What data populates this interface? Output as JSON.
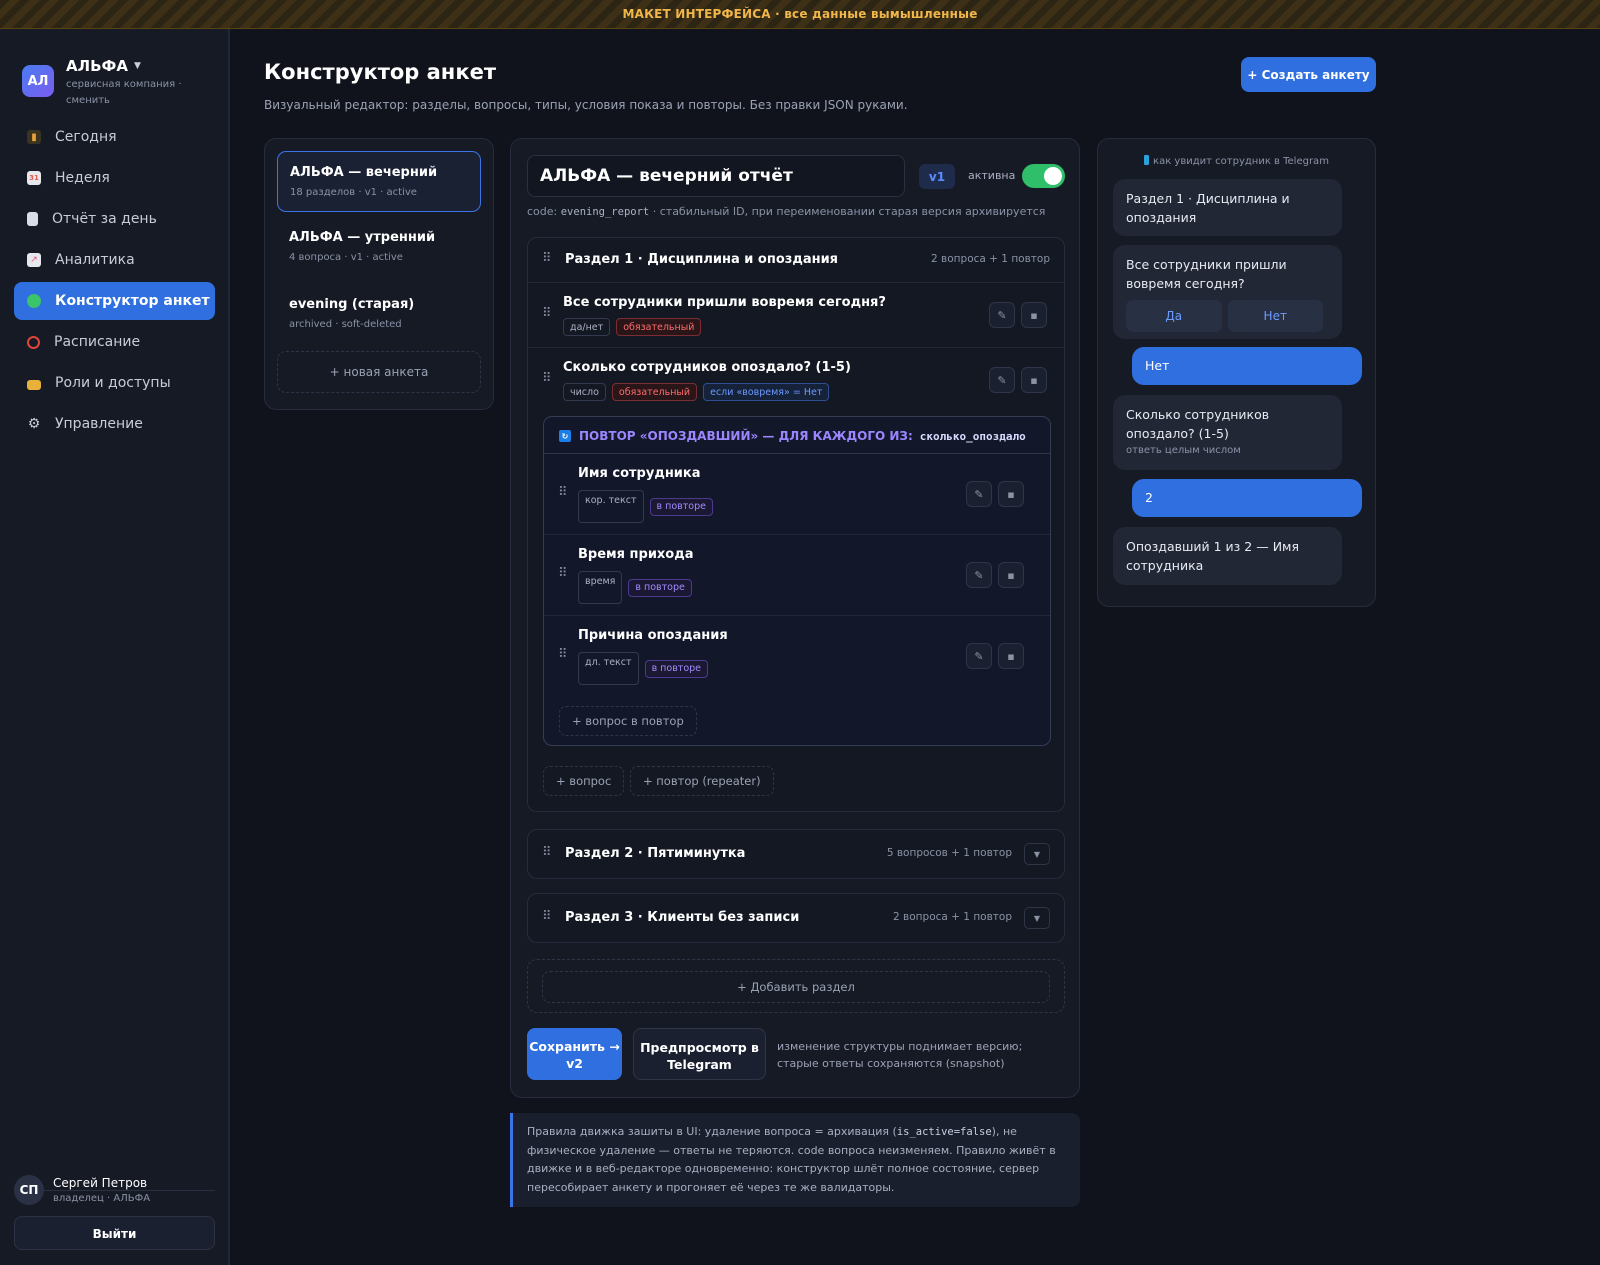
{
  "banner": {
    "text": "МАКЕТ ИНТЕРФЕЙСА · все данные вымышленные"
  },
  "org": {
    "logo": "АЛ",
    "name": "АЛЬФА",
    "sub": "сервисная компания · сменить"
  },
  "nav": [
    {
      "label": "Сегодня",
      "icon": "bar-chart-icon",
      "color": "#e8a23a"
    },
    {
      "label": "Неделя",
      "icon": "calendar-icon",
      "color": "#e05a4a"
    },
    {
      "label": "Отчёт за день",
      "icon": "document-icon",
      "color": "#d9dde6"
    },
    {
      "label": "Аналитика",
      "icon": "trend-icon",
      "color": "#e05a7a"
    },
    {
      "label": "Конструктор анкет",
      "icon": "puzzle-icon",
      "color": "#3bc46a"
    },
    {
      "label": "Расписание",
      "icon": "alarm-clock-icon",
      "color": "#e0443a"
    },
    {
      "label": "Роли и доступы",
      "icon": "lock-icon",
      "color": "#e8b23a"
    },
    {
      "label": "Управление",
      "icon": "gear-icon",
      "color": "#aab2c4"
    }
  ],
  "user": {
    "initials": "СП",
    "name": "Сергей Петров",
    "role": "владелец · АЛЬФА",
    "logout": "Выйти"
  },
  "header": {
    "title": "Конструктор анкет",
    "subtitle": "Визуальный редактор: разделы, вопросы, типы, условия показа и повторы. Без правки JSON руками.",
    "create_button": "+ Создать анкету"
  },
  "forms": [
    {
      "title": "АЛЬФА — вечерний",
      "sub": "18 разделов · v1 · active"
    },
    {
      "title": "АЛЬФА — утренний",
      "sub": "4 вопроса · v1 · active"
    },
    {
      "title": "evening (старая)",
      "sub": "archived · soft-deleted"
    }
  ],
  "new_form": "+ новая анкета",
  "editor": {
    "name": "АЛЬФА — вечерний отчёт",
    "version": "v1",
    "active_label": "активна",
    "active": true,
    "code_prefix": "code: ",
    "code": "evening_report",
    "code_suffix": " · стабильный ID, при переименовании старая версия архивируется"
  },
  "section1": {
    "title": "Раздел 1 · Дисциплина и опоздания",
    "count": "2 вопроса + 1 повтор",
    "q1": {
      "title": "Все сотрудники пришли вовремя сегодня?",
      "type": "да/нет",
      "required": "обязательный"
    },
    "q2": {
      "title": "Сколько сотрудников опоздало? (1-5)",
      "type": "число",
      "required": "обязательный",
      "condition": "если «вовремя» = Нет"
    },
    "repeater": {
      "title": "ПОВТОР «ОПОЗДАВШИЙ» — ДЛЯ КАЖДОГО ИЗ:",
      "source": "сколько_опоздало",
      "questions": [
        {
          "title": "Имя сотрудника",
          "type": "кор. текст",
          "tag": "в повторе"
        },
        {
          "title": "Время прихода",
          "type": "время",
          "tag": "в повторе"
        },
        {
          "title": "Причина опоздания",
          "type": "дл. текст",
          "tag": "в повторе"
        }
      ],
      "add_label": "+ вопрос в повтор"
    },
    "add_question": "+ вопрос",
    "add_repeater": "+ повтор (repeater)"
  },
  "section2": {
    "title": "Раздел 2 · Пятиминутка",
    "count": "5 вопросов + 1 повтор"
  },
  "section3": {
    "title": "Раздел 3 · Клиенты без записи",
    "count": "2 вопроса + 1 повтор"
  },
  "add_section": "+ Добавить раздел",
  "save_button": "Сохранить → v2",
  "preview_button": "Предпросмотр в Telegram",
  "save_note": "изменение структуры поднимает версию; старые ответы сохраняются (snapshot)",
  "rules": {
    "p1": "Правила движка зашиты в UI: удаление вопроса = архивация (",
    "code": "is_active=false",
    "p2": "), не физическое удаление — ответы не теряются. code вопроса неизменяем. Правило живёт в движке и в веб-редакторе одновременно: конструктор шлёт полное состояние, сервер пересобирает анкету и прогоняет её через те же валидаторы."
  },
  "telegram": {
    "caption": "как увидит сотрудник в Telegram",
    "m1": "Раздел 1 · Дисциплина и опоздания",
    "m2": "Все сотрудники пришли вовремя сегодня?",
    "opt_yes": "Да",
    "opt_no": "Нет",
    "r1": "Нет",
    "m3": "Сколько сотрудников опоздало? (1-5)",
    "m3_hint": "ответь целым числом",
    "r2": "2",
    "m4": "Опоздавший 1 из 2 — Имя сотрудника"
  }
}
